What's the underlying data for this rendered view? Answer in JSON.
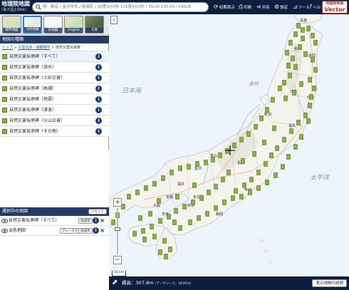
{
  "header": {
    "logo_title": "地理院地図",
    "logo_subtitle": "(電子国土Web)",
    "search_placeholder": "例：精店 / 金沢市木ノ新保町 / 35度9分0秒 135度9分0秒 / 35.00 135.00 / 54SUE",
    "buttons": [
      {
        "label": "初期表示",
        "icon": "home-reset-icon"
      },
      {
        "label": "印刷",
        "icon": "printer-icon"
      },
      {
        "label": "共有",
        "icon": "share-icon"
      },
      {
        "label": "設定",
        "icon": "gear-icon"
      },
      {
        "label": "ツール",
        "icon": "chart-tool-icon"
      },
      {
        "label": "ヘルプ",
        "icon": "question-icon"
      }
    ],
    "vector_badge_top": "地理院地図",
    "vector_badge_bottom": "Vector"
  },
  "basemaps": [
    {
      "label": "標準地図",
      "color": "#e4dcc8"
    },
    {
      "label": "淡色地図",
      "color": "#eef0ea"
    },
    {
      "label": "白地図",
      "color": "#f6f6f6"
    },
    {
      "label": "English",
      "color": "#d9e4c8"
    },
    {
      "label": "写真",
      "color": "#6d7f5c"
    }
  ],
  "panel": {
    "section_title": "地図の種類",
    "breadcrumb": [
      "トップ",
      "災害伝承・避難場所",
      "自然災害伝承碑"
    ],
    "layers": [
      {
        "label": "自然災害伝承碑（すべて）",
        "selected": true
      },
      {
        "label": "自然災害伝承碑（洪水）",
        "selected": false
      },
      {
        "label": "自然災害伝承碑（土砂災害）",
        "selected": false
      },
      {
        "label": "自然災害伝承碑（高潮）",
        "selected": false
      },
      {
        "label": "自然災害伝承碑（地震）",
        "selected": false
      },
      {
        "label": "自然災害伝承碑（津波）",
        "selected": false
      },
      {
        "label": "自然災害伝承碑（火山災害）",
        "selected": false
      },
      {
        "label": "自然災害伝承碑（その他）",
        "selected": false
      }
    ],
    "info_glyph": "i",
    "selected_title": "選択中の地図",
    "reset_label": "リセット",
    "selected_layers": [
      {
        "label": "自然災害伝承碑（すべて）",
        "tags": [
          "透過率"
        ]
      },
      {
        "label": "淡色地図",
        "tags": [
          "グレースケール",
          "透過率"
        ]
      }
    ]
  },
  "map": {
    "collapse_glyph": "‹",
    "zoom_in": "+",
    "zoom_out": "−",
    "scale_label": "50 km",
    "zoom_level_fraction": 0.55,
    "place_labels": [
      "青森",
      "秋田",
      "盛岡",
      "山形",
      "仙台",
      "新潟",
      "福島",
      "長野",
      "甲府",
      "静岡",
      "名古屋",
      "金沢",
      "福井",
      "大阪",
      "京都",
      "奈良",
      "岐阜",
      "富山",
      "本州",
      "太平洋",
      "日本海"
    ]
  },
  "footer": {
    "elevation_label": "標高：",
    "elevation_value": "307.8m",
    "elevation_source": "(データソース：DEM5A)",
    "legend_button": "表示地物の説明"
  }
}
